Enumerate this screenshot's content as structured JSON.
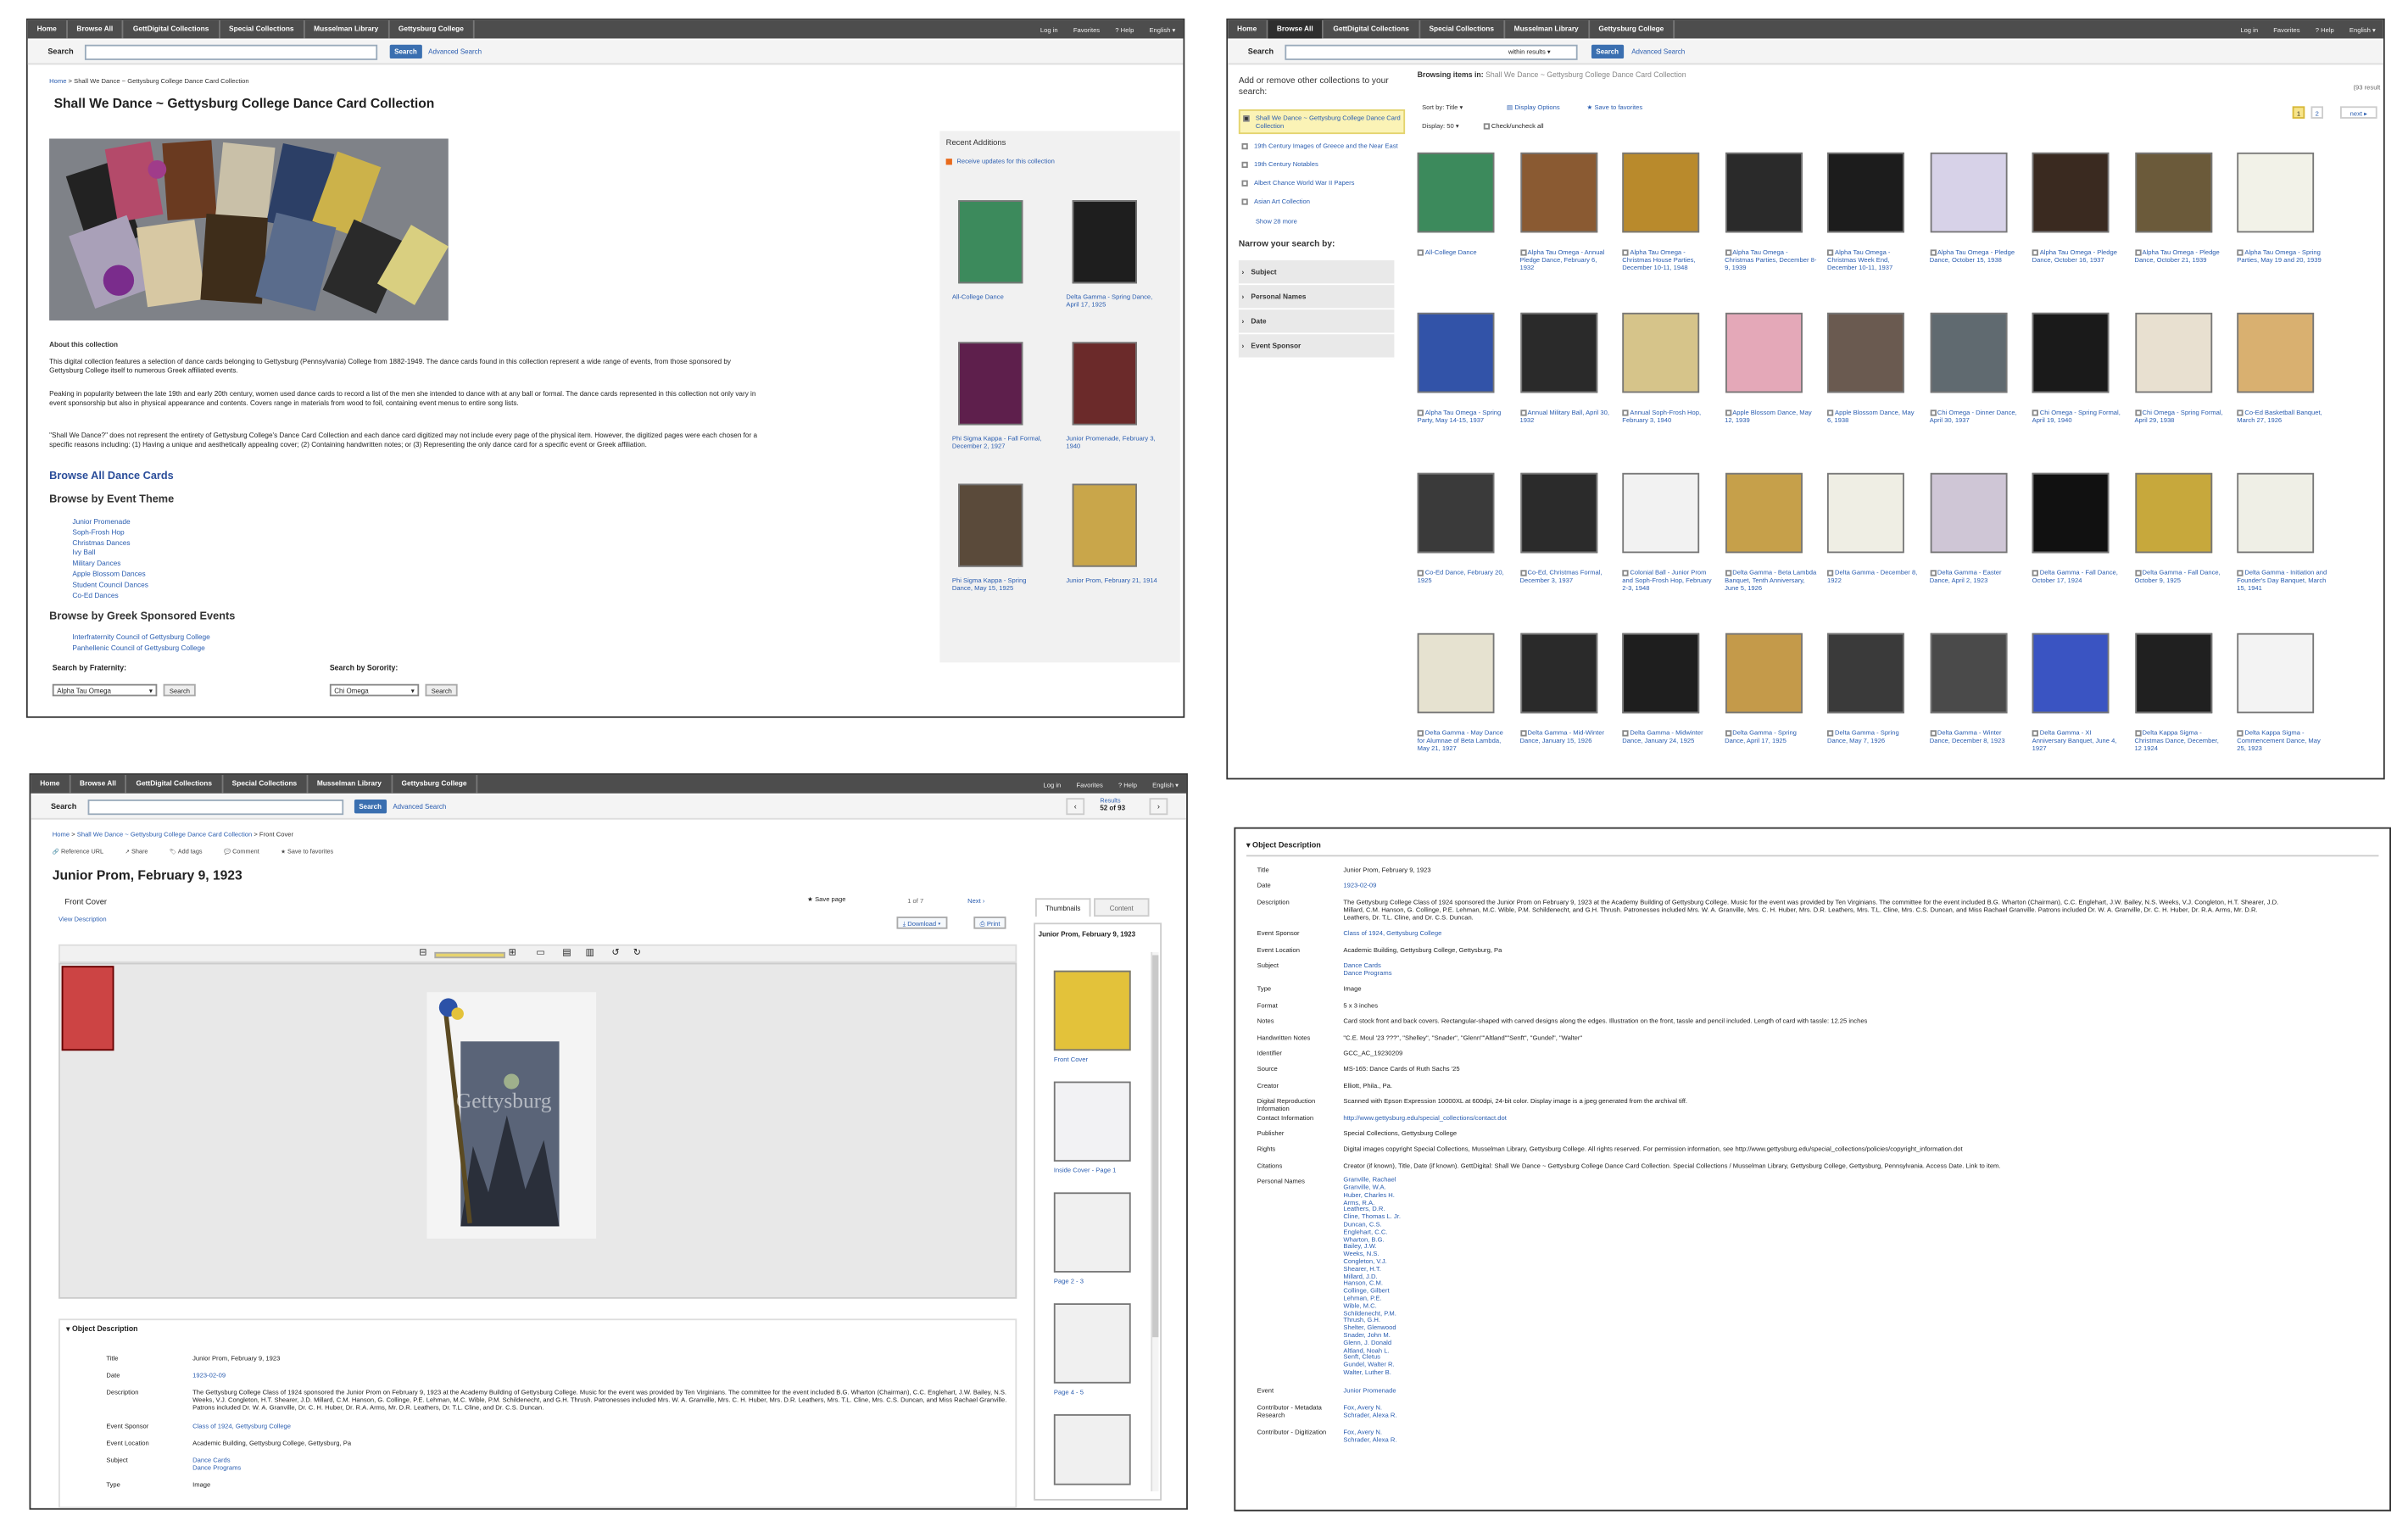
{
  "nav": {
    "tabs": [
      "Home",
      "Browse All",
      "GettDigital Collections",
      "Special Collections",
      "Musselman Library",
      "Gettysburg College"
    ],
    "right_links": [
      "Log in",
      "Favorites",
      "? Help",
      "English ▾"
    ]
  },
  "search": {
    "label": "Search",
    "button": "Search",
    "advanced": "Advanced Search",
    "within": "within results ▾"
  },
  "p1": {
    "breadcrumb_home": "Home",
    "breadcrumb_current": "Shall We Dance ~ Gettysburg College Dance Card Collection",
    "title": "Shall We Dance ~ Gettysburg College Dance Card Collection",
    "about_heading": "About this collection",
    "para1": "This digital collection features a selection of dance cards belonging to Gettysburg (Pennsylvania) College from 1882-1949. The dance cards found in this collection represent a wide range of events, from those sponsored by Gettysburg College itself to numerous Greek affiliated events.",
    "para2": "Peaking in popularity between the late 19th and early 20th century, women used dance cards to record a list of the men she intended to dance with at any ball or formal. The dance cards represented in this collection not only vary in event sponsorship but also in physical appearance and contents. Covers range in materials from wood to foil, containing event menus to entire song lists.",
    "para3": "\"Shall We Dance?\" does not represent the entirety of Gettysburg College's Dance Card Collection and each dance card digitized may not include every page of the physical item. However, the digitized pages were each chosen for a specific reasons including: (1) Having a unique and aesthetically appealing cover; (2) Containing handwritten notes; or (3) Representing the only dance card for a specific event or Greek affiliation.",
    "browse_all": "Browse All Dance Cards",
    "browse_event": "Browse by Event Theme",
    "events": [
      "Junior Promenade",
      "Soph-Frosh Hop",
      "Christmas Dances",
      "Ivy Ball",
      "Military Dances",
      "Apple Blossom Dances",
      "Student Council Dances",
      "Co-Ed Dances"
    ],
    "browse_greek": "Browse by Greek Sponsored Events",
    "greek": [
      "Interfraternity Council of Gettysburg College",
      "Panhellenic Council of Gettysburg College"
    ],
    "frat_label": "Search by Fraternity:",
    "frat_value": "Alpha Tau Omega",
    "soror_label": "Search by Sorority:",
    "soror_value": "Chi Omega",
    "recent_heading": "Recent Additions",
    "recent_rss": "Receive updates for this collection",
    "recent": [
      "All-College Dance",
      "Delta Gamma - Spring Dance, April 17, 1925",
      "Phi Sigma Kappa - Fall Formal, December 2, 1927",
      "Junior Promenade, February 3, 1940",
      "Phi Sigma Kappa - Spring Dance, May 15, 1925",
      "Junior Prom, February 21, 1914"
    ]
  },
  "p2": {
    "side_heading": "Add or remove other collections to your search:",
    "collections": [
      "Shall We Dance ~ Gettysburg College Dance Card Collection",
      "19th Century Images of Greece and the Near East",
      "19th Century Notables",
      "Albert Chance World War II Papers",
      "Asian Art Collection"
    ],
    "show_more": "Show 28 more",
    "narrow": "Narrow your search by:",
    "facets": [
      "Subject",
      "Personal Names",
      "Date",
      "Event Sponsor"
    ],
    "browsing_label": "Browsing items in:",
    "browsing_value": "Shall We Dance ~ Gettysburg College Dance Card Collection",
    "count": "(93 result",
    "sort": "Sort by: Title ▾",
    "display_opts": "Display Options",
    "save_fav": "Save to favorites",
    "display": "Display: 50 ▾",
    "check_all": "Check/uncheck all",
    "pages": [
      "1",
      "2"
    ],
    "next": "next ▸",
    "items": [
      "All-College Dance",
      "Alpha Tau Omega - Annual Pledge Dance, February 6, 1932",
      "Alpha Tau Omega - Christmas House Parties, December 10-11, 1948",
      "Alpha Tau Omega - Christmas Parties, December 8-9, 1939",
      "Alpha Tau Omega - Christmas Week End, December 10-11, 1937",
      "Alpha Tau Omega - Pledge Dance, October 15, 1938",
      "Alpha Tau Omega - Pledge Dance, October 16, 1937",
      "Alpha Tau Omega - Pledge Dance, October 21, 1939",
      "Alpha Tau Omega - Spring Parties, May 19 and 20, 1939",
      "Alpha Tau Omega - Spring Party, May 14-15, 1937",
      "Annual Military Ball, April 30, 1932",
      "Annual Soph-Frosh Hop, February 3, 1940",
      "Apple Blossom Dance, May 12, 1939",
      "Apple Blossom Dance, May 6, 1938",
      "Chi Omega - Dinner Dance, April 30, 1937",
      "Chi Omega - Spring Formal, April 19, 1940",
      "Chi Omega - Spring Formal, April 29, 1938",
      "Co-Ed Basketball Banquet, March 27, 1926",
      "Co-Ed Dance, February 20, 1925",
      "Co-Ed, Christmas Formal, December 3, 1937",
      "Colonial Ball - Junior Prom and Soph-Frosh Hop, February 2-3, 1948",
      "Delta Gamma - Beta Lambda Banquet, Tenth Anniversary, June 5, 1926",
      "Delta Gamma - December 8, 1922",
      "Delta Gamma - Easter Dance, April 2, 1923",
      "Delta Gamma - Fall Dance, October 17, 1924",
      "Delta Gamma - Fall Dance, October 9, 1925",
      "Delta Gamma - Initiation and Founder's Day Banquet, March 15, 1941",
      "Delta Gamma - May Dance for Alumnae of Beta Lambda, May 21, 1927",
      "Delta Gamma - Mid-Winter Dance, January 15, 1926",
      "Delta Gamma - Midwinter Dance, January 24, 1925",
      "Delta Gamma - Spring Dance, April 17, 1925",
      "Delta Gamma - Spring Dance, May 7, 1926",
      "Delta Gamma - Winter Dance, December 8, 1923",
      "Delta Gamma - XI Anniversary Banquet, June 4, 1927",
      "Delta Kappa Sigma - Christmas Dance, December, 12 1924",
      "Delta Kappa Sigma - Commencement Dance, May 25, 1923"
    ]
  },
  "p3": {
    "breadcrumb": [
      "Home",
      "Shall We Dance ~ Gettysburg College Dance Card Collection",
      "Front Cover"
    ],
    "results_label": "Results",
    "results_value": "52 of 93",
    "tools": [
      "Reference URL",
      "Share",
      "Add tags",
      "Comment",
      "Save to favorites"
    ],
    "title": "Junior Prom, February 9, 1923",
    "page_label": "Front Cover",
    "view_desc": "View Description",
    "save_page": "Save page",
    "page_of": "1 of 7",
    "next": "Next ›",
    "download": "Download ▾",
    "print": "Print",
    "tabs": [
      "Thumbnails",
      "Content"
    ],
    "thumb_title": "Junior Prom, February 9, 1923",
    "thumbs": [
      "Front Cover",
      "Inside Cover - Page 1",
      "Page 2 - 3",
      "Page 4 - 5"
    ],
    "image_text": "Gettysburg",
    "obj_heading": "Object Description",
    "rows": [
      {
        "k": "Title",
        "v": "Junior Prom, February 9, 1923",
        "link": false
      },
      {
        "k": "Date",
        "v": "1923-02-09",
        "link": true
      },
      {
        "k": "Description",
        "v": "The Gettysburg College Class of 1924 sponsored the Junior Prom on February 9, 1923 at the Academy Building of Gettysburg College. Music for the event was provided by Ten Virginians. The committee for the event included B.G. Wharton (Chairman), C.C. Englehart, J.W. Bailey, N.S. Weeks, V.J. Congleton, H.T. Shearer, J.D. Millard, C.M. Hanson, G. Collinge, P.E. Lehman, M.C. Wible, P.M. Schildenecht, and G.H. Thrush. Patronesses included Mrs. W. A. Granville, Mrs. C. H. Huber, Mrs. D.R. Leathers, Mrs. T.L. Cline, Mrs. C.S. Duncan, and Miss Rachael Granville. Patrons included Dr. W. A. Granville, Dr. C. H. Huber, Dr. R.A. Arms, Mr. D.R. Leathers, Dr. T.L. Cline, and Dr. C.S. Duncan.",
        "link": false
      },
      {
        "k": "Event Sponsor",
        "v": "Class of 1924, Gettysburg College",
        "link": true
      },
      {
        "k": "Event Location",
        "v": "Academic Building, Gettysburg College, Gettysburg, Pa",
        "link": false
      },
      {
        "k": "Subject",
        "v": "Dance Cards\nDance Programs",
        "link": true
      },
      {
        "k": "Type",
        "v": "Image",
        "link": false
      }
    ]
  },
  "p4": {
    "heading": "Object Description",
    "rows": [
      {
        "k": "Title",
        "v": "Junior Prom, February 9, 1923",
        "link": false
      },
      {
        "k": "Date",
        "v": "1923-02-09",
        "link": true
      },
      {
        "k": "Description",
        "v": "The Gettysburg College Class of 1924 sponsored the Junior Prom on February 9, 1923 at the Academy Building of Gettysburg College. Music for the event was provided by Ten Virginians. The committee for the event included B.G. Wharton (Chairman), C.C. Englehart, J.W. Bailey, N.S. Weeks, V.J. Congleton, H.T. Shearer, J.D. Millard, C.M. Hanson, G. Collinge, P.E. Lehman, M.C. Wible, P.M. Schildenecht, and G.H. Thrush. Patronesses included Mrs. W. A. Granville, Mrs. C. H. Huber, Mrs. D.R. Leathers, Mrs. T.L. Cline, Mrs. C.S. Duncan, and Miss Rachael Granville. Patrons included Dr. W. A. Granville, Dr. C. H. Huber, Dr. R.A. Arms, Mr. D.R. Leathers, Dr. T.L. Cline, and Dr. C.S. Duncan.",
        "link": false
      },
      {
        "k": "Event Sponsor",
        "v": "Class of 1924, Gettysburg College",
        "link": true
      },
      {
        "k": "Event Location",
        "v": "Academic Building, Gettysburg College, Gettysburg, Pa",
        "link": false
      },
      {
        "k": "Subject",
        "v": "Dance Cards\nDance Programs",
        "link": true
      },
      {
        "k": "Type",
        "v": "Image",
        "link": false
      },
      {
        "k": "Format",
        "v": "5 x 3 inches",
        "link": false
      },
      {
        "k": "Notes",
        "v": "Card stock front and back covers. Rectangular-shaped with carved designs along the edges. Illustration on the front, tassle and pencil included. Length of card with tassle: 12.25 inches",
        "link": false
      },
      {
        "k": "Handwritten Notes",
        "v": "\"C.E. Moul '23 ???\", \"Shelley\", \"Snader\", \"Glenn\"\"Altland\"\"Senft\", \"Gundel\", \"Walter\"",
        "link": false
      },
      {
        "k": "Identifier",
        "v": "GCC_AC_19230209",
        "link": false
      },
      {
        "k": "Source",
        "v": "MS-165: Dance Cards of Ruth Sachs '25",
        "link": false
      },
      {
        "k": "Creator",
        "v": "Elliott, Phila., Pa.",
        "link": false
      },
      {
        "k": "Digital Reproduction Information",
        "v": "Scanned with Epson Expression 10000XL at 600dpi, 24-bit color. Display image is a jpeg generated from the archival tiff.",
        "link": false
      },
      {
        "k": "Contact Information",
        "v": "http://www.gettysburg.edu/special_collections/contact.dot",
        "link": true
      },
      {
        "k": "Publisher",
        "v": "Special Collections, Gettysburg College",
        "link": false
      },
      {
        "k": "Rights",
        "v": "Digital images copyright Special Collections, Musselman Library, Gettysburg College. All rights reserved. For permission information, see http://www.gettysburg.edu/special_collections/policies/copyright_information.dot",
        "link": false
      },
      {
        "k": "Citations",
        "v": "Creator (if known), Title, Date (if known). GettDigital: Shall We Dance ~ Gettysburg College Dance Card Collection. Special Collections / Musselman Library, Gettysburg College, Gettysburg, Pennsylvania. Access Date. Link to item.",
        "link": false
      }
    ],
    "names_key": "Personal Names",
    "names": [
      "Granville, Rachael",
      "Granville, W.A.",
      "Huber, Charles H.",
      "Arms, R.A.",
      "Leathers, D.R.",
      "Cline, Thomas L. Jr.",
      "Duncan, C.S.",
      "Englehart, C.C.",
      "Wharton, B.G.",
      "Bailey, J.W.",
      "Weeks, N.S.",
      "Congleton, V.J.",
      "Shearer, H.T.",
      "Millard, J.D.",
      "Hanson, C.M.",
      "Collinge, Gilbert",
      "Lehman, P.E.",
      "Wible, M.C.",
      "Schildenecht, P.M.",
      "Thrush, G.H.",
      "Shelter, Glenwood",
      "Snader, John M.",
      "Glenn, J. Donald",
      "Altland, Noah L.",
      "Senft, Cletus",
      "Gundel, Walter R.",
      "Walter, Luther B."
    ],
    "tail": [
      {
        "k": "Event",
        "v": "Junior Promenade",
        "link": true
      },
      {
        "k": "Contributor - Metadata Research",
        "v": "Fox, Avery N.\nSchrader, Alexa R.",
        "link": true
      },
      {
        "k": "Contributor - Digitization",
        "v": "Fox, Avery N.\nSchrader, Alexa R.",
        "link": true
      }
    ]
  }
}
